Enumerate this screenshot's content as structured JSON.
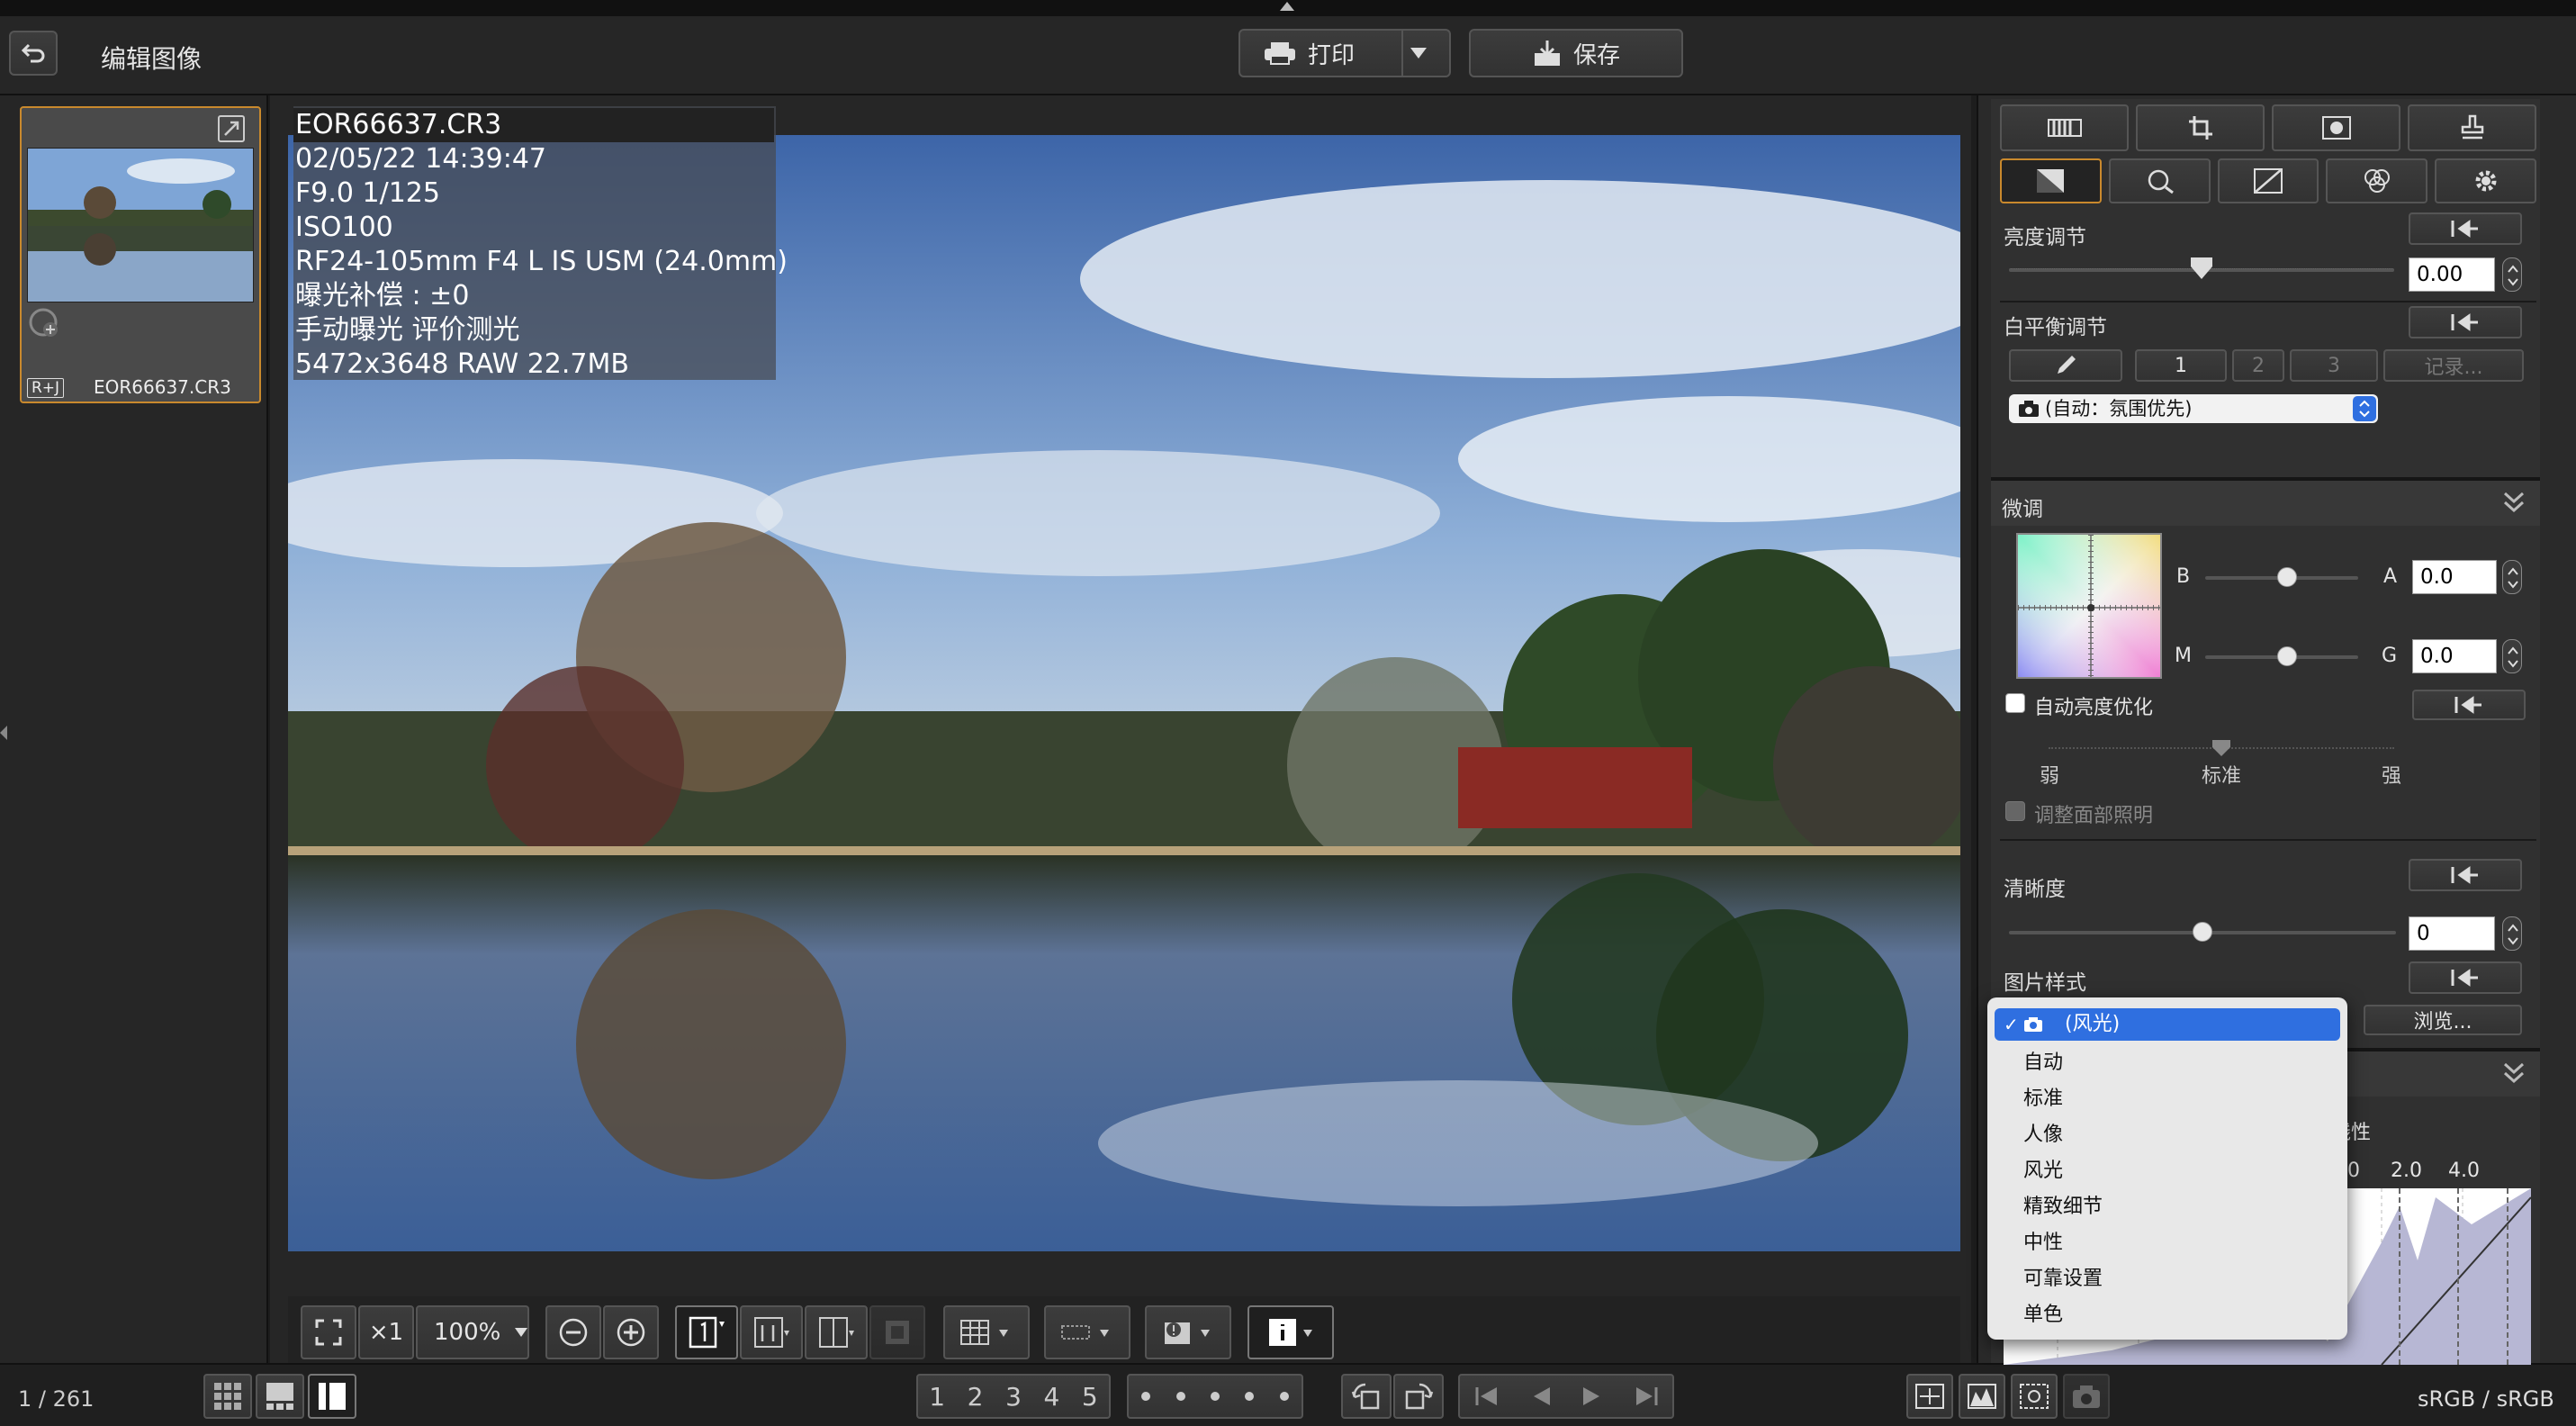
{
  "window": {
    "title": "编辑图像"
  },
  "toolbar": {
    "print_label": "打印",
    "save_label": "保存"
  },
  "thumbnail": {
    "name": "EOR66637.CR3",
    "badge": "R+J"
  },
  "info_overlay": {
    "lines": [
      "EOR66637.CR3",
      "02/05/22 14:39:47",
      "F9.0 1/125",
      "ISO100",
      "RF24-105mm F4 L IS USM (24.0mm)",
      "曝光补偿 : ±0",
      "手动曝光 评价测光",
      "5472x3648 RAW 22.7MB"
    ]
  },
  "view_tools": {
    "zoom_multiplier": "×1",
    "zoom_percent": "100%"
  },
  "status": {
    "count": "1 / 261",
    "color_space": "sRGB / sRGB"
  },
  "ratings": [
    "1",
    "2",
    "3",
    "4",
    "5"
  ],
  "right_panel": {
    "brightness": {
      "label": "亮度调节",
      "value": "0.00",
      "level": 0.5
    },
    "white_balance": {
      "label": "白平衡调节",
      "tabs": [
        "1",
        "2",
        "3"
      ],
      "record_label": "记录...",
      "select_value": "(自动：氛围优先)"
    },
    "fine_tune": {
      "label": "微调",
      "b_label": "B",
      "a_label": "A",
      "a_value": "0.0",
      "m_label": "M",
      "g_label": "G",
      "g_value": "0.0"
    },
    "auto_lighting": {
      "label": "自动亮度优化",
      "levels": [
        "弱",
        "标准",
        "强"
      ],
      "face_label": "调整面部照明"
    },
    "clarity": {
      "label": "清晰度",
      "value": "0",
      "level": 0.5
    },
    "picture_style": {
      "label": "图片样式",
      "browse_label": "浏览..."
    },
    "tone_curve": {
      "partial_label": "线性",
      "ticks": [
        "0",
        "2.0",
        "4.0"
      ]
    }
  },
  "picture_style_menu": {
    "selected": "(风光)",
    "options": [
      "自动",
      "标准",
      "人像",
      "风光",
      "精致细节",
      "中性",
      "可靠设置",
      "单色"
    ]
  }
}
